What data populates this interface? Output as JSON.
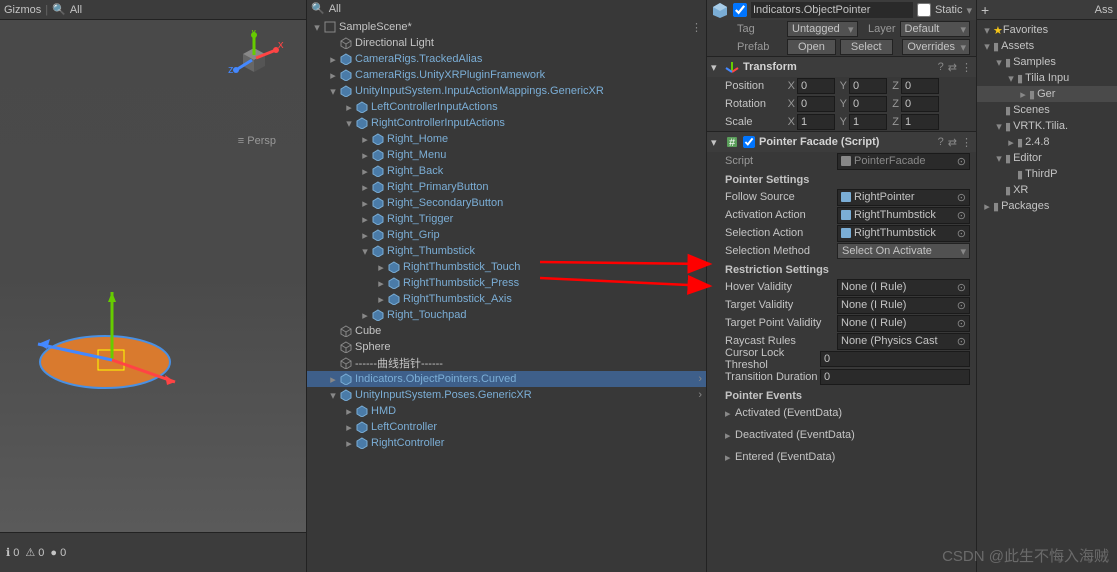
{
  "scene": {
    "gizmos_label": "Gizmos",
    "all_label": "All",
    "persp": "≡ Persp"
  },
  "hierarchy": {
    "root": "SampleScene*",
    "items": [
      {
        "depth": 1,
        "fold": "",
        "label": "Directional Light",
        "prefab": false
      },
      {
        "depth": 1,
        "fold": "▸",
        "label": "CameraRigs.TrackedAlias",
        "prefab": true
      },
      {
        "depth": 1,
        "fold": "▸",
        "label": "CameraRigs.UnityXRPluginFramework",
        "prefab": true
      },
      {
        "depth": 1,
        "fold": "▾",
        "label": "UnityInputSystem.InputActionMappings.GenericXR",
        "prefab": true
      },
      {
        "depth": 2,
        "fold": "▸",
        "label": "LeftControllerInputActions",
        "prefab": true
      },
      {
        "depth": 2,
        "fold": "▾",
        "label": "RightControllerInputActions",
        "prefab": true
      },
      {
        "depth": 3,
        "fold": "▸",
        "label": "Right_Home",
        "prefab": true
      },
      {
        "depth": 3,
        "fold": "▸",
        "label": "Right_Menu",
        "prefab": true
      },
      {
        "depth": 3,
        "fold": "▸",
        "label": "Right_Back",
        "prefab": true
      },
      {
        "depth": 3,
        "fold": "▸",
        "label": "Right_PrimaryButton",
        "prefab": true
      },
      {
        "depth": 3,
        "fold": "▸",
        "label": "Right_SecondaryButton",
        "prefab": true
      },
      {
        "depth": 3,
        "fold": "▸",
        "label": "Right_Trigger",
        "prefab": true
      },
      {
        "depth": 3,
        "fold": "▸",
        "label": "Right_Grip",
        "prefab": true
      },
      {
        "depth": 3,
        "fold": "▾",
        "label": "Right_Thumbstick",
        "prefab": true
      },
      {
        "depth": 4,
        "fold": "▸",
        "label": "RightThumbstick_Touch",
        "prefab": true
      },
      {
        "depth": 4,
        "fold": "▸",
        "label": "RightThumbstick_Press",
        "prefab": true
      },
      {
        "depth": 4,
        "fold": "▸",
        "label": "RightThumbstick_Axis",
        "prefab": true
      },
      {
        "depth": 3,
        "fold": "▸",
        "label": "Right_Touchpad",
        "prefab": true
      },
      {
        "depth": 1,
        "fold": "",
        "label": "Cube",
        "prefab": false
      },
      {
        "depth": 1,
        "fold": "",
        "label": "Sphere",
        "prefab": false
      },
      {
        "depth": 1,
        "fold": "",
        "label": "------曲线指针------",
        "prefab": false
      },
      {
        "depth": 1,
        "fold": "▸",
        "label": "Indicators.ObjectPointers.Curved",
        "prefab": true,
        "selected": true,
        "arrow": true
      },
      {
        "depth": 1,
        "fold": "▾",
        "label": "UnityInputSystem.Poses.GenericXR",
        "prefab": true,
        "arrow": true
      },
      {
        "depth": 2,
        "fold": "▸",
        "label": "HMD",
        "prefab": true
      },
      {
        "depth": 2,
        "fold": "▸",
        "label": "LeftController",
        "prefab": true
      },
      {
        "depth": 2,
        "fold": "▸",
        "label": "RightController",
        "prefab": true
      }
    ]
  },
  "inspector": {
    "name": "Indicators.ObjectPointer",
    "static_label": "Static",
    "tag_label": "Tag",
    "tag_value": "Untagged",
    "layer_label": "Layer",
    "layer_value": "Default",
    "prefab_label": "Prefab",
    "open_btn": "Open",
    "select_btn": "Select",
    "overrides_btn": "Overrides",
    "transform": {
      "title": "Transform",
      "position": "Position",
      "rotation": "Rotation",
      "scale": "Scale",
      "px": "0",
      "py": "0",
      "pz": "0",
      "rx": "0",
      "ry": "0",
      "rz": "0",
      "sx": "1",
      "sy": "1",
      "sz": "1"
    },
    "facade": {
      "title": "Pointer Facade (Script)",
      "script_label": "Script",
      "script_value": "PointerFacade",
      "settings_label": "Pointer Settings",
      "follow_source": "Follow Source",
      "follow_val": "RightPointer",
      "activation": "Activation Action",
      "activation_val": "RightThumbstick",
      "selection": "Selection Action",
      "selection_val": "RightThumbstick",
      "selmethod": "Selection Method",
      "selmethod_val": "Select On Activate",
      "restrict_label": "Restriction Settings",
      "hover": "Hover Validity",
      "hover_val": "None (I Rule)",
      "target": "Target Validity",
      "target_val": "None (I Rule)",
      "tpoint": "Target Point Validity",
      "tpoint_val": "None (I Rule)",
      "raycast": "Raycast Rules",
      "raycast_val": "None (Physics Cast",
      "cursor": "Cursor Lock Threshol",
      "cursor_val": "0",
      "transition": "Transition Duration",
      "transition_val": "0",
      "events_label": "Pointer Events",
      "ev1": "Activated (EventData)",
      "ev2": "Deactivated (EventData)",
      "ev3": "Entered (EventData)"
    }
  },
  "project": {
    "favorites": "Favorites",
    "assets_tab": "Ass",
    "items": [
      {
        "d": 0,
        "f": "▾",
        "label": "Assets"
      },
      {
        "d": 1,
        "f": "▾",
        "label": "Samples"
      },
      {
        "d": 2,
        "f": "▾",
        "label": "Tilia Inpu"
      },
      {
        "d": 3,
        "f": "▸",
        "label": "Ger",
        "sel": true
      },
      {
        "d": 1,
        "f": "",
        "label": "Scenes"
      },
      {
        "d": 1,
        "f": "▾",
        "label": "VRTK.Tilia."
      },
      {
        "d": 2,
        "f": "▸",
        "label": "2.4.8"
      },
      {
        "d": 1,
        "f": "▾",
        "label": "Editor"
      },
      {
        "d": 2,
        "f": "",
        "label": "ThirdP"
      },
      {
        "d": 1,
        "f": "",
        "label": "XR"
      },
      {
        "d": 0,
        "f": "▸",
        "label": "Packages"
      }
    ]
  },
  "status": {
    "warn": "0",
    "err": "0",
    "info": "0"
  },
  "watermark": "CSDN @此生不悔入海贼"
}
